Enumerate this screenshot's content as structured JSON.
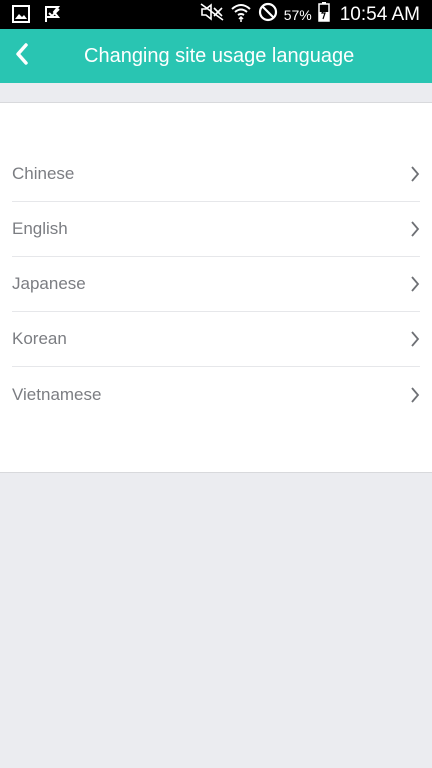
{
  "status_bar": {
    "battery_percent": "57%",
    "time": "10:54 AM",
    "icons": [
      "gallery-icon",
      "flag-icon",
      "mute-icon",
      "wifi-icon",
      "block-icon",
      "battery-icon"
    ]
  },
  "header": {
    "title": "Changing site usage language",
    "background_color": "#29c5b2",
    "back_icon": "chevron-left-icon"
  },
  "languages": [
    {
      "label": "Chinese"
    },
    {
      "label": "English"
    },
    {
      "label": "Japanese"
    },
    {
      "label": "Korean"
    },
    {
      "label": "Vietnamese"
    }
  ]
}
